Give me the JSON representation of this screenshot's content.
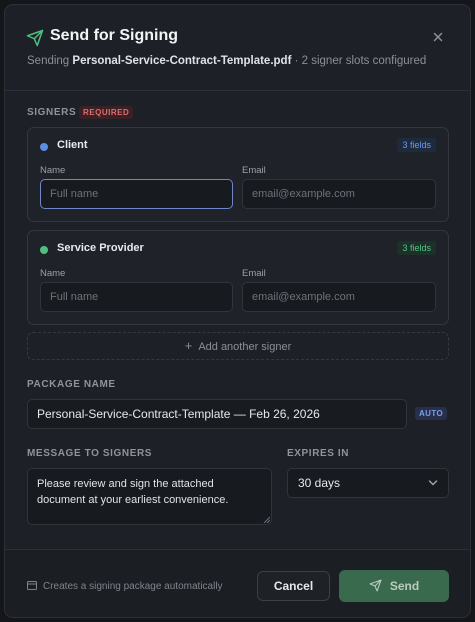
{
  "dialog": {
    "title": "Send for Signing",
    "subtitle_prefix": "Sending",
    "file_name": "Personal-Service-Contract-Template.pdf",
    "subtitle_suffix": "· 2 signer slots configured"
  },
  "signers_section": {
    "label": "Signers",
    "required_badge": "REQUIRED",
    "signers": [
      {
        "role": "Client",
        "fields_badge": "3 fields",
        "dot_color": "#5b8fe0",
        "name_label": "Name",
        "name_placeholder": "Full name",
        "email_label": "Email",
        "email_placeholder": "email@example.com"
      },
      {
        "role": "Service Provider",
        "fields_badge": "3 fields",
        "dot_color": "#4fbf80",
        "name_label": "Name",
        "name_placeholder": "Full name",
        "email_label": "Email",
        "email_placeholder": "email@example.com"
      }
    ],
    "add_signer_label": "Add another signer"
  },
  "package": {
    "label": "Package Name",
    "value": "Personal-Service-Contract-Template — Feb 26, 2026",
    "auto_badge": "AUTO"
  },
  "message": {
    "label": "Message to Signers",
    "value": "Please review and sign the attached document at your earliest convenience."
  },
  "expires": {
    "label": "Expires In",
    "value": "30 days"
  },
  "footer": {
    "note": "Creates a signing package automatically",
    "cancel_label": "Cancel",
    "send_label": "Send"
  },
  "colors": {
    "accent_green": "#3a6a4e",
    "client_dot": "#5b8fe0",
    "provider_dot": "#4fbf80",
    "required_red": "#e06c6c"
  }
}
